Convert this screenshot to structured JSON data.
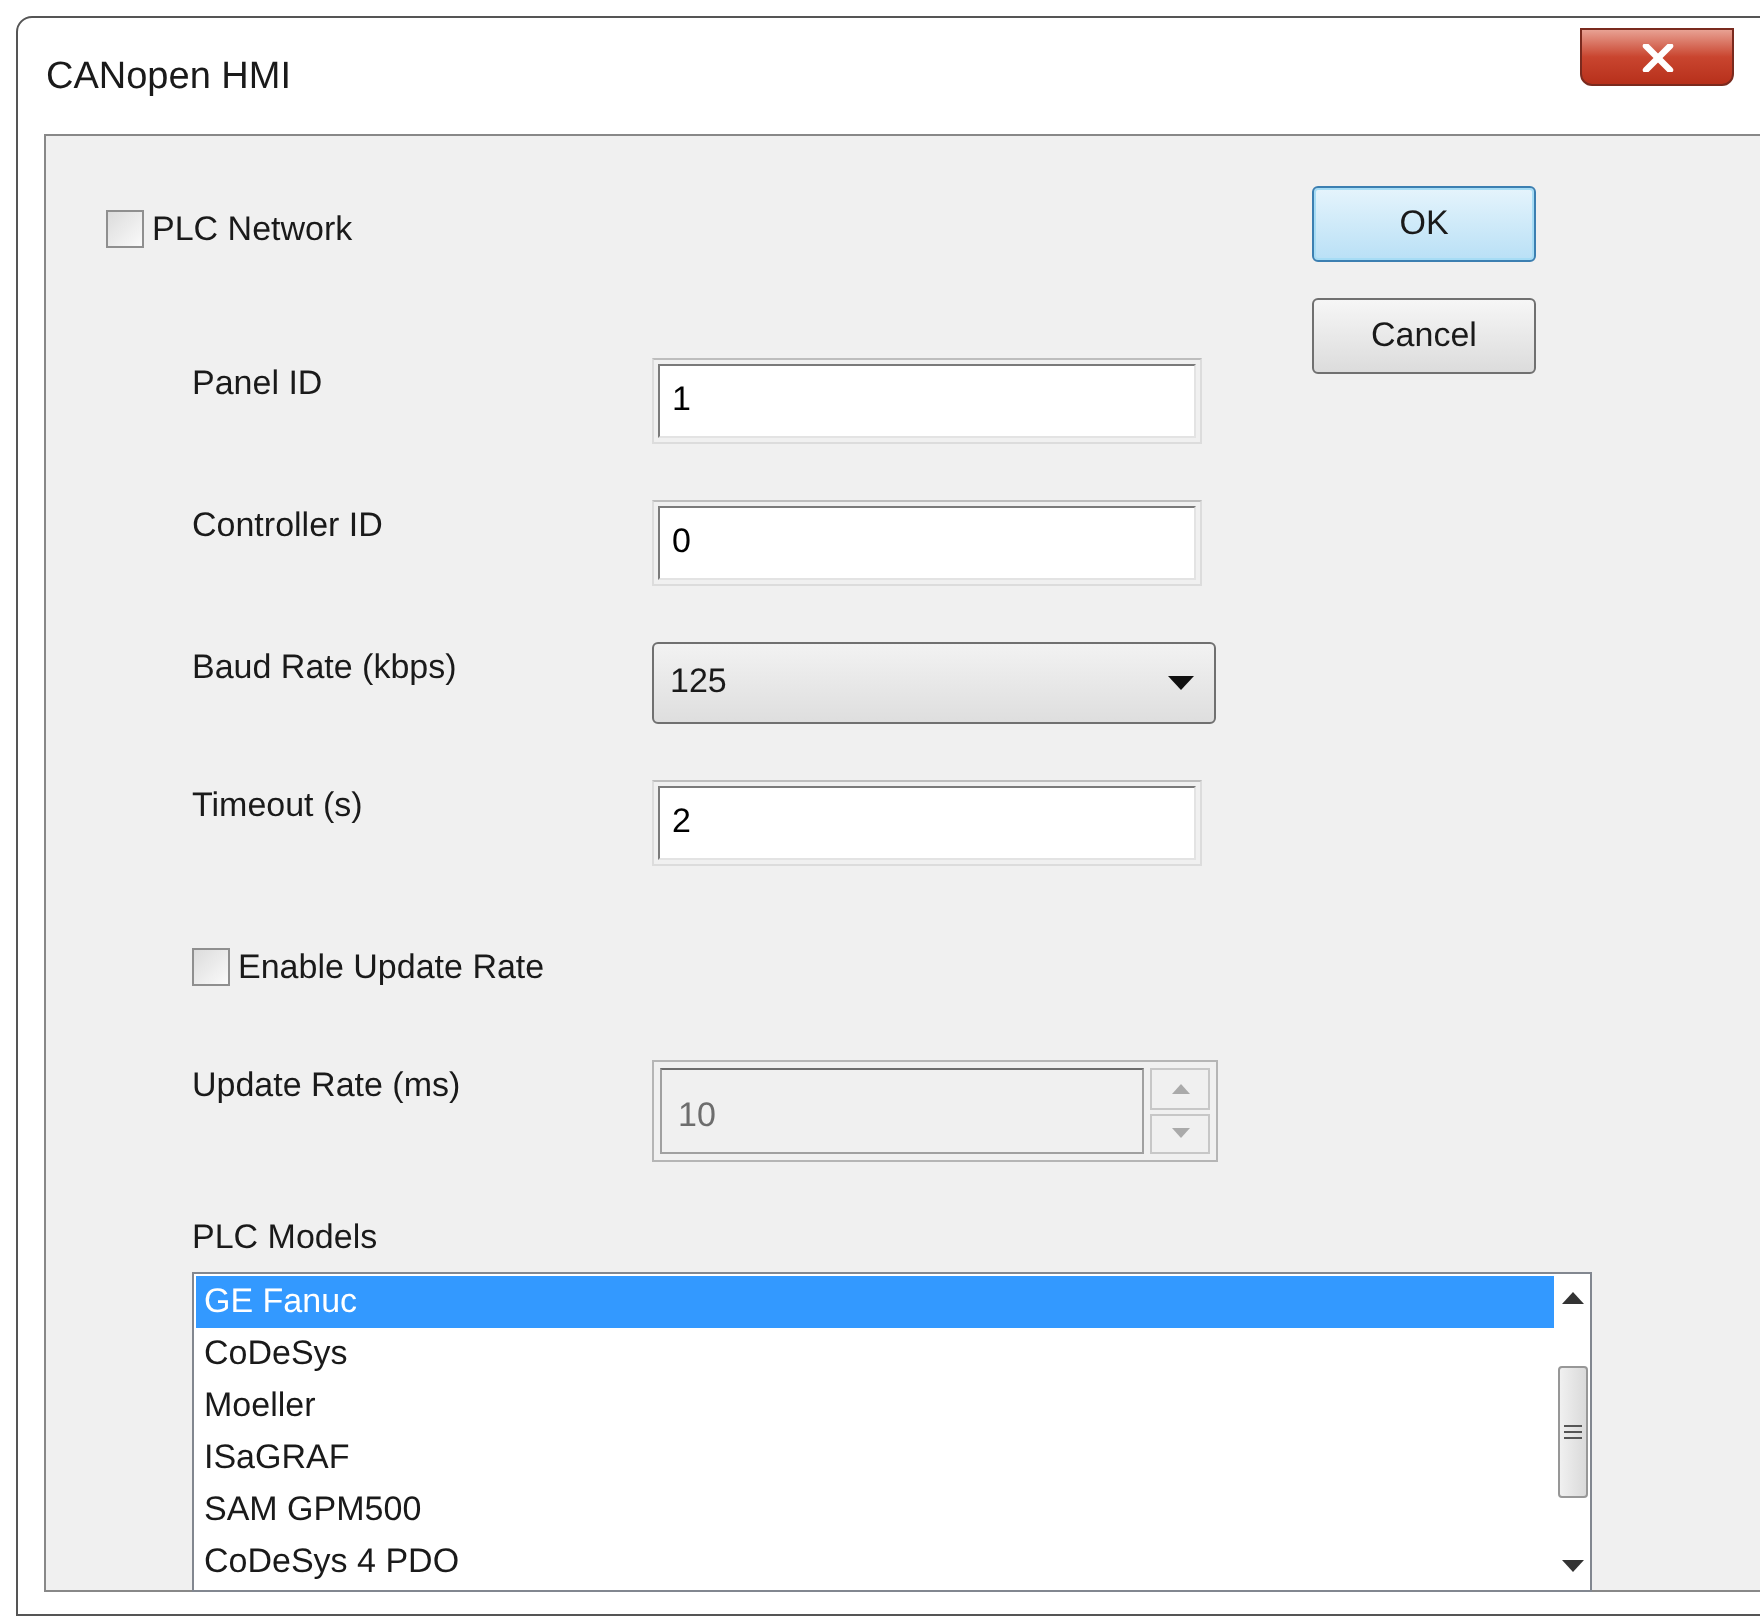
{
  "window": {
    "title": "CANopen HMI"
  },
  "plc_network": {
    "label": "PLC Network",
    "checked": false
  },
  "buttons": [
    {
      "label": "OK",
      "focused": true
    },
    {
      "label": "Cancel",
      "focused": false
    }
  ],
  "fields": [
    {
      "kind": "text",
      "label": "Panel ID",
      "value": "1"
    },
    {
      "kind": "text",
      "label": "Controller ID",
      "value": "0"
    },
    {
      "kind": "select",
      "label": "Baud Rate (kbps)",
      "value": "125"
    },
    {
      "kind": "text",
      "label": "Timeout (s)",
      "value": "2"
    }
  ],
  "enable_update_rate": {
    "label": "Enable Update Rate",
    "checked": false
  },
  "update_rate": {
    "label": "Update Rate (ms)",
    "value": "10",
    "disabled": true
  },
  "plc_models": {
    "label": "PLC Models",
    "items": [
      {
        "label": "GE Fanuc",
        "selected": true
      },
      {
        "label": "CoDeSys",
        "selected": false
      },
      {
        "label": "Moeller",
        "selected": false
      },
      {
        "label": "ISaGRAF",
        "selected": false
      },
      {
        "label": "SAM GPM500",
        "selected": false
      },
      {
        "label": "CoDeSys 4 PDO",
        "selected": false
      }
    ]
  }
}
